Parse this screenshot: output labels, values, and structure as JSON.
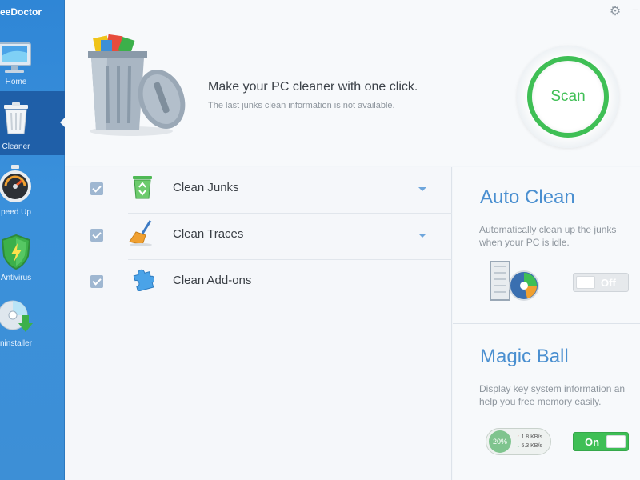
{
  "app": {
    "title": "eeDoctor"
  },
  "sidebar": {
    "items": [
      {
        "label": "Home",
        "icon": "monitor-icon",
        "active": false
      },
      {
        "label": "Cleaner",
        "icon": "trash-can-icon",
        "active": true
      },
      {
        "label": "peed Up",
        "icon": "speedometer-icon",
        "active": false
      },
      {
        "label": "Antivirus",
        "icon": "shield-icon",
        "active": false
      },
      {
        "label": "ninstaller",
        "icon": "disc-download-icon",
        "active": false
      }
    ]
  },
  "header": {
    "gear_icon": "⚙",
    "minimize_icon": "−",
    "headline": "Make your PC cleaner with one click.",
    "subline": "The last junks clean information is not available.",
    "scan_label": "Scan"
  },
  "clean_items": [
    {
      "label": "Clean Junks",
      "checked": true,
      "has_dropdown": true
    },
    {
      "label": "Clean Traces",
      "checked": true,
      "has_dropdown": true
    },
    {
      "label": "Clean Add-ons",
      "checked": true,
      "has_dropdown": false
    }
  ],
  "auto_clean": {
    "title": "Auto Clean",
    "desc_line1": "Automatically clean up the junks",
    "desc_line2": "when your PC is idle.",
    "toggle_label": "Off",
    "enabled": false
  },
  "magic_ball": {
    "title": "Magic Ball",
    "desc_line1": "Display key system information an",
    "desc_line2": "help you free memory easily.",
    "percent": "20%",
    "upload": "1.8 KB/s",
    "download": "5.3 KB/s",
    "toggle_label": "On",
    "enabled": true
  },
  "colors": {
    "accent": "#3fbf55",
    "sidebar": "#3a90db",
    "title_blue": "#4a8fd0"
  }
}
